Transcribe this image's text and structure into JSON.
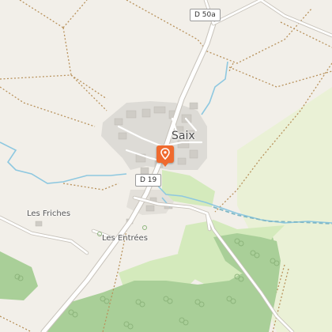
{
  "map": {
    "road_labels": {
      "d50a": "D 50a",
      "d19": "D 19"
    },
    "places": {
      "village": "Saix",
      "les_friches": "Les Friches",
      "les_entrees": "Les Entrées"
    },
    "marker": {
      "icon": "location-pin-icon",
      "color": "#ef6a2e"
    },
    "colors": {
      "land": "#f2efe9",
      "forest": "#a9cf98",
      "meadow": "#d4eabc",
      "field": "#eaf1d6",
      "built_up": "#dddbd6",
      "water": "#8ec8e0",
      "road": "#ffffff",
      "boundary": "#b8925c"
    }
  }
}
